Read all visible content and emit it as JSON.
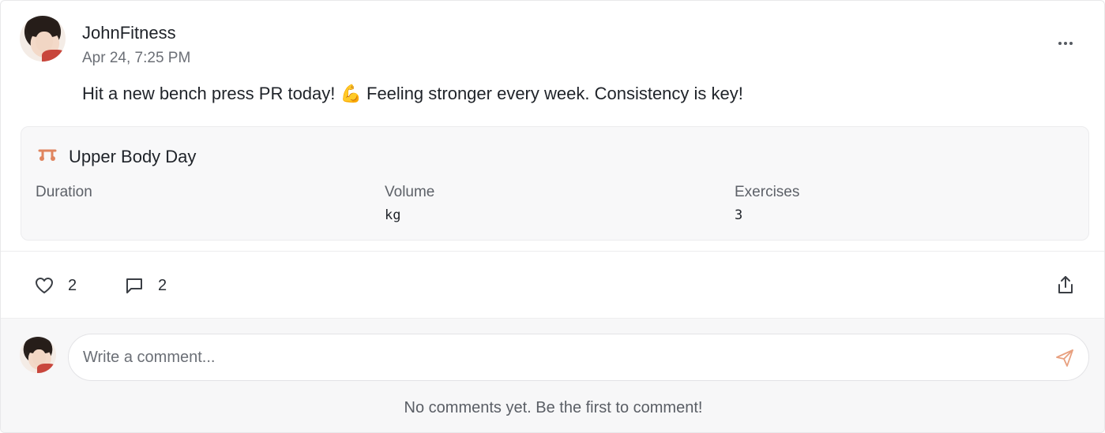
{
  "post": {
    "username": "JohnFitness",
    "timestamp": "Apr 24, 7:25 PM",
    "text": "Hit a new bench press PR today! 💪 Feeling stronger every week. Consistency is key!",
    "more_icon": "more-horizontal-icon"
  },
  "workout": {
    "icon": "dumbbell-icon",
    "icon_color": "#e0855f",
    "title": "Upper Body Day",
    "stats": {
      "duration": {
        "label": "Duration",
        "value": ""
      },
      "volume": {
        "label": "Volume",
        "value": "kg"
      },
      "exercises": {
        "label": "Exercises",
        "value": "3"
      }
    }
  },
  "actions": {
    "likes": {
      "icon": "heart-icon",
      "count": "2"
    },
    "comments": {
      "icon": "comment-icon",
      "count": "2"
    },
    "share_icon": "share-icon"
  },
  "comment_box": {
    "placeholder": "Write a comment...",
    "send_icon": "send-icon",
    "send_color": "#e8a07f",
    "empty_message": "No comments yet. Be the first to comment!"
  }
}
